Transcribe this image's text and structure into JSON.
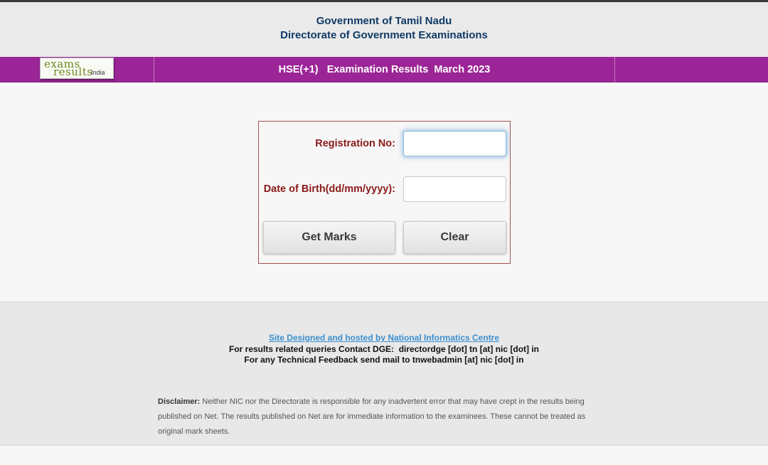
{
  "header": {
    "line1": "Government of Tamil Nadu",
    "line2": "Directorate of Government Examinations"
  },
  "logo": {
    "word1": "exams",
    "word2": "results",
    "word3": "India"
  },
  "band": {
    "title": "HSE(+1)   Examination Results  March 2023",
    "color": "#9b2596"
  },
  "form": {
    "registration_label": "Registration No:",
    "registration_value": "",
    "dob_label": "Date of Birth(dd/mm/yyyy):",
    "dob_value": "",
    "get_marks_label": "Get Marks",
    "clear_label": "Clear"
  },
  "footer": {
    "link": "Site Designed and hosted by National Informatics Centre",
    "contact": "For results related queries Contact DGE:  directordge [dot] tn [at] nic [dot] in",
    "feedback": "For any Technical Feedback send mail to tnwebadmin [at] nic [dot] in",
    "disclaimer_heading": "Disclaimer:",
    "disclaimer_text": " Neither NIC nor the Directorate is responsible for any inadvertent error that may have crept in the results being published on Net. The results published on Net are for immediate information to the examinees. These cannot be treated as original mark sheets."
  }
}
